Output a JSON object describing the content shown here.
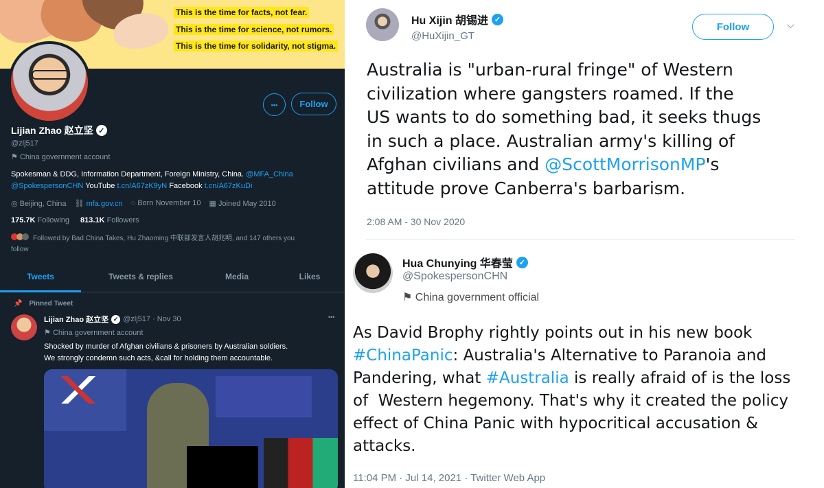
{
  "left_profile": {
    "banner_lines": [
      "This is the time for facts, not fear.",
      "This is the time for science, not rumors.",
      "This is the time for solidarity, not stigma."
    ],
    "follow_label": "Follow",
    "more_label": "•••",
    "name": "Lijian Zhao 赵立坚",
    "handle": "@zlj517",
    "account_label": "China government account",
    "bio_line1_text": "Spokesman & DDG, Information Department, Foreign Ministry, China.",
    "bio_line1_mention": "@MFA_China",
    "bio_line2_mention": "@SpokespersonCHN",
    "bio_line2_youtube": "YouTube",
    "bio_line2_youtube_link": "t.cn/A67zK9yN",
    "bio_line2_facebook": "Facebook",
    "bio_line2_facebook_link": "t.cn/A67zKuDi",
    "location": "Beijing, China",
    "website": "mfa.gov.cn",
    "born": "Born November 10",
    "joined": "Joined May 2010",
    "following_count": "175.7K",
    "following_label": "Following",
    "followers_count": "813.1K",
    "followers_label": "Followers",
    "followed_by_line1": "Followed by Bad China Takes, Hu Zhaoming 中联部发言人胡兆明, and 147 others you",
    "followed_by_line2": "follow",
    "tabs": [
      "Tweets",
      "Tweets & replies",
      "Media",
      "Likes"
    ],
    "pinned_label": "Pinned Tweet",
    "tweet_name": "Lijian Zhao 赵立坚",
    "tweet_handle_date": "@zlj517 · Nov 30",
    "tweet_account_label": "China government account",
    "tweet_text_line1": "Shocked by murder of Afghan civilians & prisoners by Australian soldiers.",
    "tweet_text_line2": "We strongly condemn such acts, &call for holding them accountable."
  },
  "hu_tweet": {
    "name": "Hu Xijin 胡锡进",
    "handle": "@HuXijin_GT",
    "follow_label": "Follow",
    "text_lines": [
      "Australia is \"urban-rural fringe\" of Western",
      "civilization where gangsters roamed. If the",
      "US wants to do something bad, it seeks thugs",
      "in such a place. Australian army's killing of"
    ],
    "text_line5_pre": "Afghan civilians and ",
    "text_line5_mention": "@ScottMorrisonMP",
    "text_line5_post": "'s",
    "text_line6": "attitude prove Canberra's barbarism.",
    "timestamp": "2:08 AM - 30 Nov 2020"
  },
  "hua_tweet": {
    "name": "Hua Chunying 华春莹",
    "handle": "@SpokespersonCHN",
    "account_label": "China government official",
    "line1": "As David Brophy rightly points out in his new book",
    "line2_hashtag": "#ChinaPanic",
    "line2_rest": ": Australia's Alternative to Paranoia and",
    "line3_pre": "Pandering, what ",
    "line3_hashtag": "#Australia",
    "line3_post": " is really afraid of is the loss",
    "line4": "of  Western hegemony. That's why it created the policy",
    "line5": "effect of China Panic with hypocritical accusation &",
    "line6": "attacks.",
    "timestamp": "11:04 PM · Jul 14, 2021 · Twitter Web App"
  },
  "colors": {
    "twitter_blue": "#1da1f2",
    "dark_bg": "#15202b",
    "muted_gray": "#8899a6",
    "banner_yellow": "#ffe61c"
  }
}
